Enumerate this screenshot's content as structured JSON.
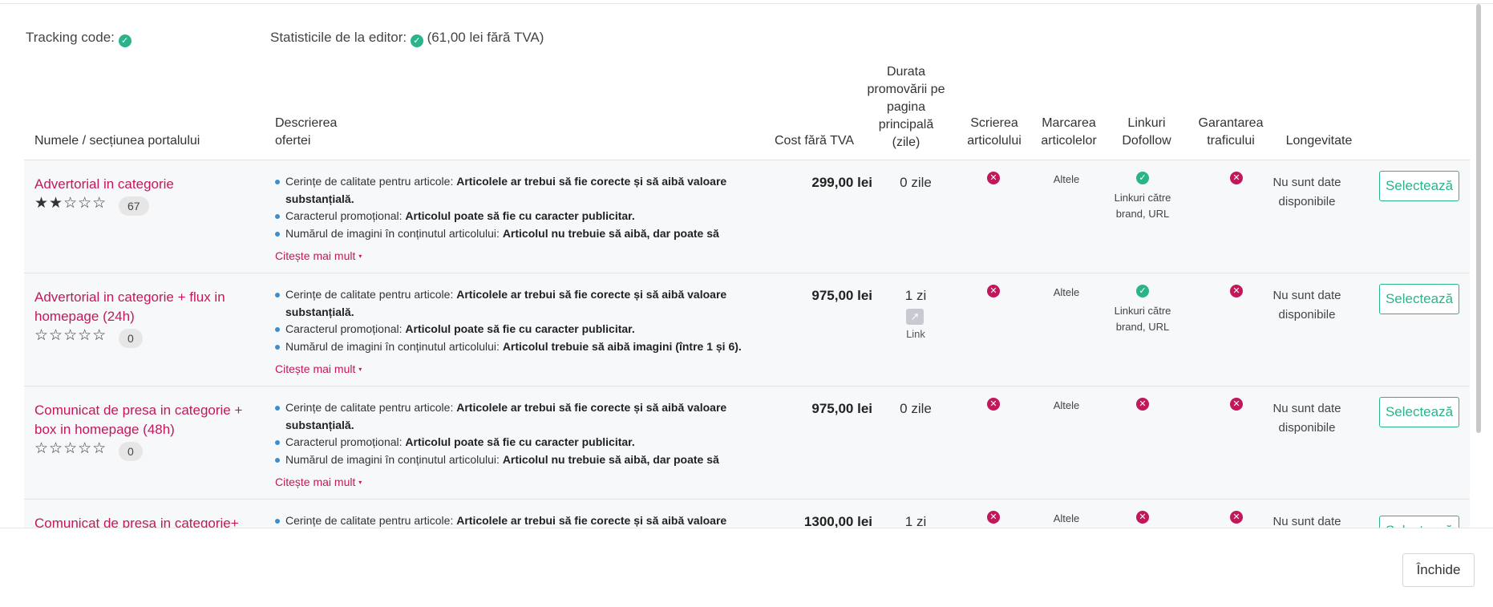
{
  "info": {
    "tracking_label": "Tracking code:",
    "stats_label": "Statisticile de la editor:",
    "stats_price": "(61,00 lei fără TVA)"
  },
  "headers": {
    "name": "Numele / secțiunea portalului",
    "desc_line1": "Descrierea",
    "desc_line2": "ofertei",
    "cost": "Cost fără TVA",
    "duration": [
      "Durata",
      "promovării pe",
      "pagina",
      "principală",
      "(zile)"
    ],
    "writing": [
      "Scrierea",
      "articolului"
    ],
    "marking": [
      "Marcarea",
      "articolelor"
    ],
    "dofollow": [
      "Linkuri",
      "Dofollow"
    ],
    "traffic": [
      "Garantarea",
      "traficului"
    ],
    "longevity": "Longevitate"
  },
  "common": {
    "q_label": "Cerințe de calitate pentru articole: ",
    "q_value_a": "Articolele ar trebui să fie corecte și să aibă valoare",
    "q_value_b": "substanțială.",
    "p_label": "Caracterul promoțional: ",
    "p_value": "Articolul poate să fie cu caracter publicitar.",
    "i_label": "Numărul de imagini în conținutul articolului: ",
    "more": "Citește mai mult",
    "marking_value": "Altele",
    "longevity_a": "Nu sunt date",
    "longevity_b": "disponibile",
    "select": "Selectează",
    "link_label": "Link",
    "dofollow_note_a": "Linkuri către",
    "dofollow_note_b": "brand, URL",
    "stars_label": "☆☆☆☆☆"
  },
  "rows": [
    {
      "name": "Advertorial in categorie",
      "stars": "★★☆☆☆",
      "reviews": "67",
      "images_value": "Articolul nu trebuie să aibă, dar poate să",
      "cost": "299,00 lei",
      "duration": "0 zile"
    },
    {
      "name": "Advertorial in categorie + flux in homepage (24h)",
      "stars": "☆☆☆☆☆",
      "reviews": "0",
      "images_value": "Articolul trebuie să aibă imagini (între 1 și 6).",
      "cost": "975,00 lei",
      "duration": "1 zi"
    },
    {
      "name": "Comunicat de presa in categorie + box in homepage (48h)",
      "stars": "☆☆☆☆☆",
      "reviews": "0",
      "images_value": "Articolul nu trebuie să aibă, dar poate să",
      "cost": "975,00 lei",
      "duration": "0 zile"
    },
    {
      "name": "Comunicat de presa in categorie+ box",
      "cost": "1300,00 lei",
      "duration": "1 zi"
    }
  ],
  "footer": {
    "close": "Închide"
  },
  "colors": {
    "accent_red": "#c2185b",
    "accent_green": "#2bb38c",
    "bullet_blue": "#3b8fd0"
  }
}
